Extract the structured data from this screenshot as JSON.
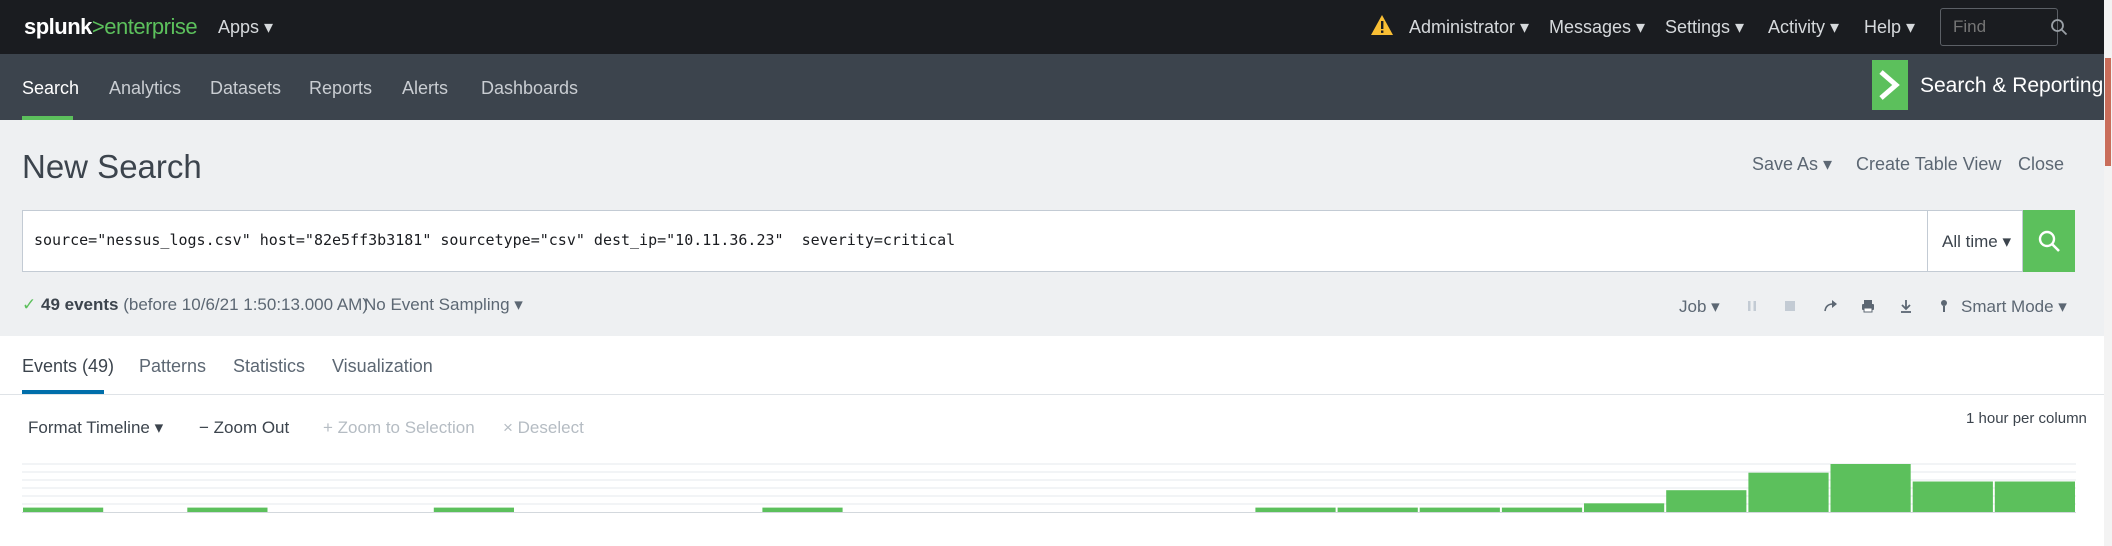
{
  "topbar": {
    "logo_left": "splunk",
    "logo_sep": ">",
    "logo_right": "enterprise",
    "apps": "Apps ▾",
    "nav": [
      {
        "label": "Administrator ▾"
      },
      {
        "label": "Messages ▾"
      },
      {
        "label": "Settings ▾"
      },
      {
        "label": "Activity ▾"
      },
      {
        "label": "Help ▾"
      }
    ],
    "find_placeholder": "Find"
  },
  "appbar": {
    "tabs": [
      {
        "label": "Search"
      },
      {
        "label": "Analytics"
      },
      {
        "label": "Datasets"
      },
      {
        "label": "Reports"
      },
      {
        "label": "Alerts"
      },
      {
        "label": "Dashboards"
      }
    ],
    "app_title": "Search & Reporting"
  },
  "page": {
    "title": "New Search",
    "actions": {
      "save_as": "Save As ▾",
      "create_table_view": "Create Table View",
      "close": "Close"
    }
  },
  "search": {
    "query": "source=\"nessus_logs.csv\" host=\"82e5ff3b3181\" sourcetype=\"csv\" dest_ip=\"10.11.36.23\"  severity=critical",
    "time_range": "All time ▾"
  },
  "status": {
    "check": "✓",
    "events_count": "49 events",
    "before": "(before 10/6/21 1:50:13.000 AM)",
    "sampling": "No Event Sampling ▾",
    "job": "Job ▾",
    "mode": "Smart Mode ▾"
  },
  "results_tabs": [
    {
      "label": "Events (49)"
    },
    {
      "label": "Patterns"
    },
    {
      "label": "Statistics"
    },
    {
      "label": "Visualization"
    }
  ],
  "timeline": {
    "format": "Format Timeline ▾",
    "zoom_out": "− Zoom Out",
    "zoom_selection": "+ Zoom to Selection",
    "deselect": "× Deselect",
    "scale_label": "1 hour per column",
    "bar_levels": [
      1,
      0,
      1,
      0,
      0,
      1,
      0,
      0,
      0,
      1,
      0,
      0,
      0,
      0,
      0,
      1,
      1,
      1,
      1,
      2,
      5,
      9,
      11,
      7,
      7
    ],
    "bar_max": 11
  },
  "colors": {
    "accent_green": "#5cc05c",
    "topbar": "#1a1c20",
    "appbar": "#3c444d",
    "tab_blue": "#006eaa"
  }
}
